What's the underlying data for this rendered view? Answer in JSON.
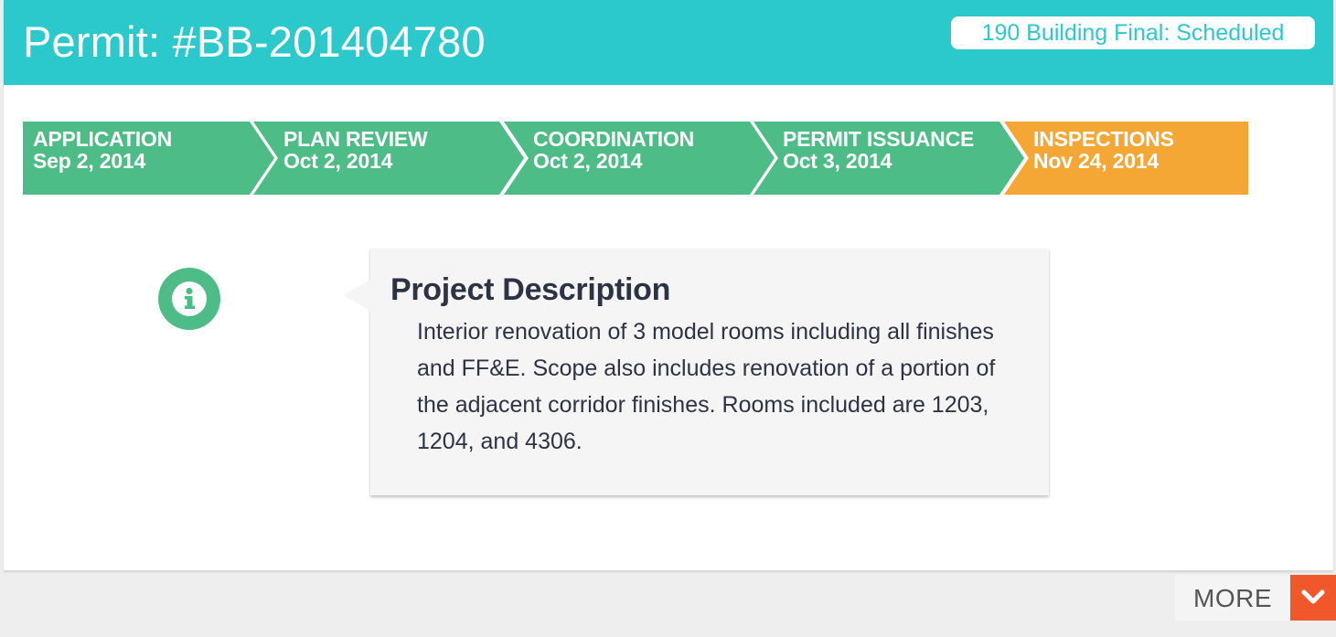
{
  "header": {
    "title": "Permit: #BB-201404780",
    "status": "190 Building Final: Scheduled"
  },
  "steps": [
    {
      "label": "APPLICATION",
      "date": "Sep 2, 2014",
      "state": "complete"
    },
    {
      "label": "PLAN REVIEW",
      "date": "Oct 2, 2014",
      "state": "complete"
    },
    {
      "label": "COORDINATION",
      "date": "Oct 2, 2014",
      "state": "complete"
    },
    {
      "label": "PERMIT ISSUANCE",
      "date": "Oct 3, 2014",
      "state": "complete"
    },
    {
      "label": "INSPECTIONS",
      "date": "Nov 24, 2014",
      "state": "current"
    }
  ],
  "description": {
    "icon": "info-icon",
    "title": "Project Description",
    "body": "Interior renovation of 3 model rooms including all finishes and FF&E. Scope also includes renovation of a portion of the adjacent corridor finishes. Rooms included are 1203, 1204, and 4306."
  },
  "more": {
    "label": "MORE",
    "icon": "chevron-down-icon"
  },
  "colors": {
    "header": "#2bc9cb",
    "step_complete": "#4ebc86",
    "step_current": "#f5a735",
    "info_icon": "#4ebc86",
    "text_dark": "#2c3444",
    "more_accent": "#f0582b"
  }
}
